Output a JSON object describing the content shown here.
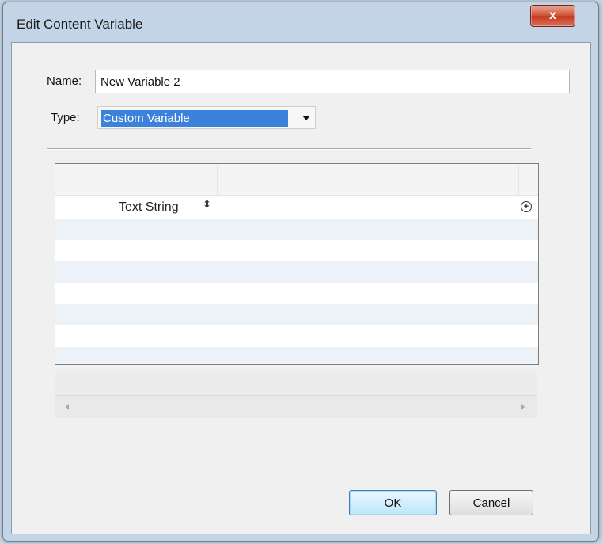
{
  "window": {
    "title": "Edit Content Variable",
    "close_glyph": "x"
  },
  "form": {
    "name_label": "Name:",
    "name_value": "New Variable 2",
    "type_label": "Type:",
    "type_value": "Custom Variable"
  },
  "grid": {
    "rows": [
      {
        "label": "Text String",
        "sort_glyph": "⬍",
        "add_glyph": "+"
      }
    ]
  },
  "buttons": {
    "ok": "OK",
    "cancel": "Cancel"
  },
  "colors": {
    "selection": "#3c82db",
    "close_button": "#c4391f"
  }
}
